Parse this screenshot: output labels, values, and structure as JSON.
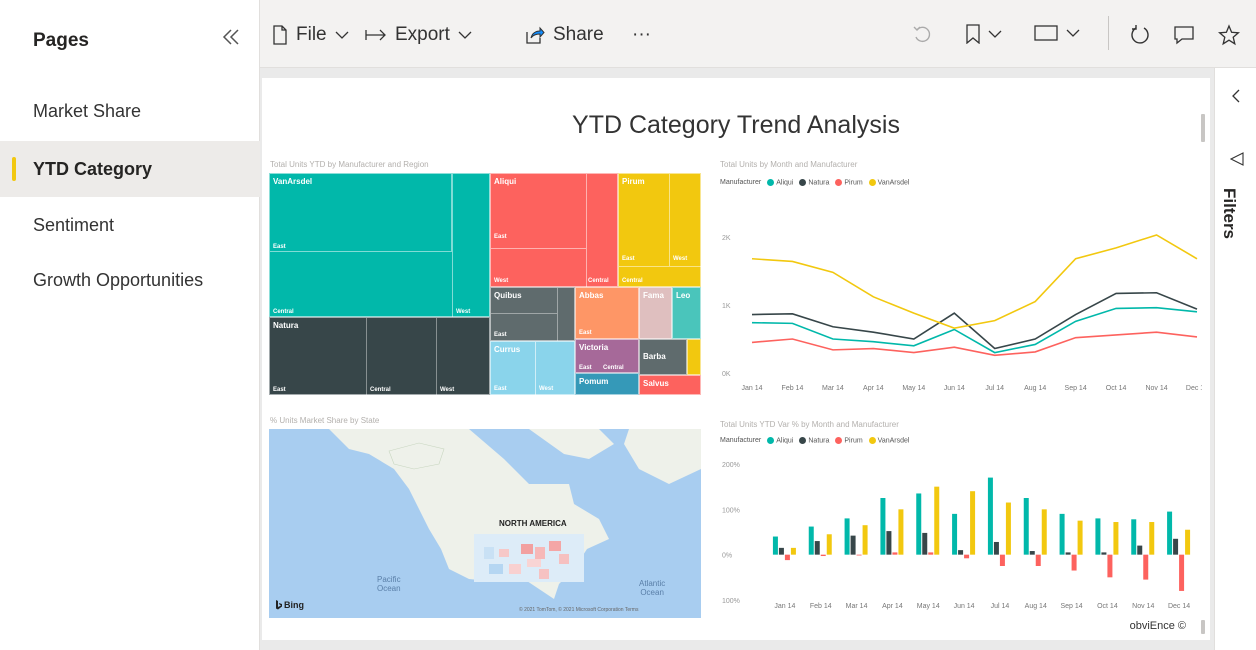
{
  "pages_panel": {
    "title": "Pages",
    "items": [
      {
        "label": "Market Share"
      },
      {
        "label": "YTD Category"
      },
      {
        "label": "Sentiment"
      },
      {
        "label": "Growth Opportunities"
      }
    ]
  },
  "toolbar": {
    "file_label": "File",
    "export_label": "Export",
    "share_label": "Share",
    "more_label": "···"
  },
  "filters_label": "Filters",
  "report": {
    "title": "YTD Category Trend Analysis",
    "treemap": {
      "title": "Total Units YTD by Manufacturer and Region",
      "tiles": [
        {
          "name": "VanArsdel",
          "color": "#01b8aa"
        },
        {
          "name": "Natura",
          "color": "#374649"
        },
        {
          "name": "Aliqui",
          "color": "#fd625e"
        },
        {
          "name": "Pirum",
          "color": "#f2c80f"
        },
        {
          "name": "Quibus",
          "color": "#5f6b6d"
        },
        {
          "name": "Abbas",
          "color": "#fe9666"
        },
        {
          "name": "Fama",
          "color": "#dfbfbf"
        },
        {
          "name": "Leo",
          "color": "#4ac5bb"
        },
        {
          "name": "Currus",
          "color": "#8ad4eb"
        },
        {
          "name": "Victoria",
          "color": "#a66999"
        },
        {
          "name": "Barba",
          "color": "#5f6b6d"
        },
        {
          "name": "Pomum",
          "color": "#3599b8"
        },
        {
          "name": "Salvus",
          "color": "#fd625e"
        }
      ],
      "regions": {
        "east": "East",
        "west": "West",
        "central": "Central"
      }
    },
    "map": {
      "title": "% Units Market Share by State",
      "label_na": "NORTH AMERICA",
      "label_pacific": "Pacific\nOcean",
      "label_atlantic": "Atlantic\nOcean",
      "bing": "Bing",
      "copyright": "© 2021 TomTom, © 2021 Microsoft Corporation  Terms"
    },
    "line_chart_title": "Total Units by Month and Manufacturer",
    "bar_chart_title": "Total Units YTD Var % by Month and Manufacturer",
    "legend_title": "Manufacturer",
    "footer": "obviEnce ©"
  },
  "chart_data": [
    {
      "type": "line",
      "title": "Total Units by Month and Manufacturer",
      "x": [
        "Jan 14",
        "Feb 14",
        "Mar 14",
        "Apr 14",
        "May 14",
        "Jun 14",
        "Jul 14",
        "Aug 14",
        "Sep 14",
        "Oct 14",
        "Nov 14",
        "Dec 14"
      ],
      "y_ticks": [
        "0K",
        "1K",
        "2K"
      ],
      "ylim": [
        0,
        2500
      ],
      "series": [
        {
          "name": "Aliqui",
          "color": "#01b8aa",
          "values": [
            740,
            730,
            500,
            460,
            400,
            640,
            300,
            420,
            760,
            950,
            960,
            900
          ]
        },
        {
          "name": "Natura",
          "color": "#374649",
          "values": [
            860,
            870,
            680,
            600,
            500,
            880,
            360,
            500,
            860,
            1170,
            1180,
            940
          ]
        },
        {
          "name": "Pirum",
          "color": "#fd625e",
          "values": [
            450,
            500,
            340,
            360,
            300,
            380,
            260,
            310,
            520,
            560,
            600,
            530
          ]
        },
        {
          "name": "VanArsdel",
          "color": "#f2c80f",
          "values": [
            1680,
            1640,
            1480,
            1120,
            880,
            660,
            770,
            1050,
            1680,
            1840,
            2030,
            1680
          ]
        }
      ]
    },
    {
      "type": "bar",
      "title": "Total Units YTD Var % by Month and Manufacturer",
      "categories": [
        "Jan 14",
        "Feb 14",
        "Mar 14",
        "Apr 14",
        "May 14",
        "Jun 14",
        "Jul 14",
        "Aug 14",
        "Sep 14",
        "Oct 14",
        "Nov 14",
        "Dec 14"
      ],
      "y_ticks": [
        "100%",
        "0%",
        "100%",
        "200%"
      ],
      "ylim": [
        -100,
        200
      ],
      "series": [
        {
          "name": "Aliqui",
          "color": "#01b8aa",
          "values": [
            40,
            62,
            80,
            125,
            135,
            90,
            170,
            125,
            90,
            80,
            78,
            95
          ]
        },
        {
          "name": "Natura",
          "color": "#374649",
          "values": [
            15,
            30,
            42,
            52,
            48,
            10,
            28,
            8,
            5,
            5,
            20,
            35
          ]
        },
        {
          "name": "Pirum",
          "color": "#fd625e",
          "values": [
            -12,
            -3,
            0,
            5,
            5,
            -8,
            -25,
            -25,
            -35,
            -50,
            -55,
            -80
          ]
        },
        {
          "name": "VanArsdel",
          "color": "#f2c80f",
          "values": [
            15,
            45,
            65,
            100,
            150,
            140,
            115,
            100,
            75,
            72,
            72,
            55
          ]
        }
      ]
    }
  ]
}
